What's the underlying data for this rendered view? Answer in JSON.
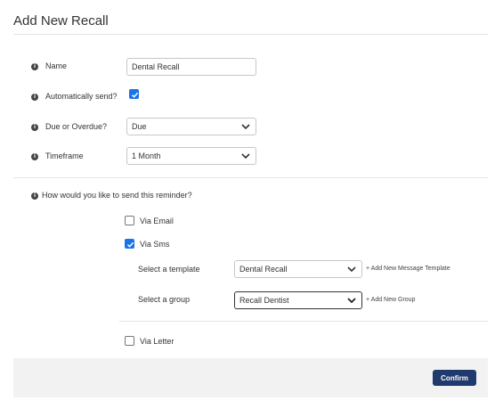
{
  "header": {
    "title": "Add New Recall"
  },
  "form": {
    "name": {
      "label": "Name",
      "value": "Dental Recall"
    },
    "auto_send": {
      "label": "Automatically send?",
      "checked": true
    },
    "due": {
      "label": "Due or Overdue?",
      "selected": "Due"
    },
    "timeframe": {
      "label": "Timeframe",
      "selected": "1 Month"
    }
  },
  "send_method": {
    "question": "How would you like to send this reminder?",
    "email": {
      "label": "Via Email",
      "checked": false
    },
    "sms": {
      "label": "Via Sms",
      "checked": true,
      "template": {
        "label": "Select a template",
        "selected": "Dental Recall",
        "add_link": "+ Add New Message Template"
      },
      "group": {
        "label": "Select a group",
        "selected": "Recall Dentist",
        "add_link": "+ Add New Group"
      }
    },
    "letter": {
      "label": "Via Letter",
      "checked": false
    }
  },
  "footer": {
    "confirm_label": "Confirm"
  },
  "colors": {
    "accent": "#1a73e8",
    "confirm_bg": "#213a6e",
    "footer_bg": "#f2f2f2"
  },
  "icons": {
    "info": "info-icon",
    "chevron": "chevron-down-icon",
    "check": "checkmark-icon"
  }
}
